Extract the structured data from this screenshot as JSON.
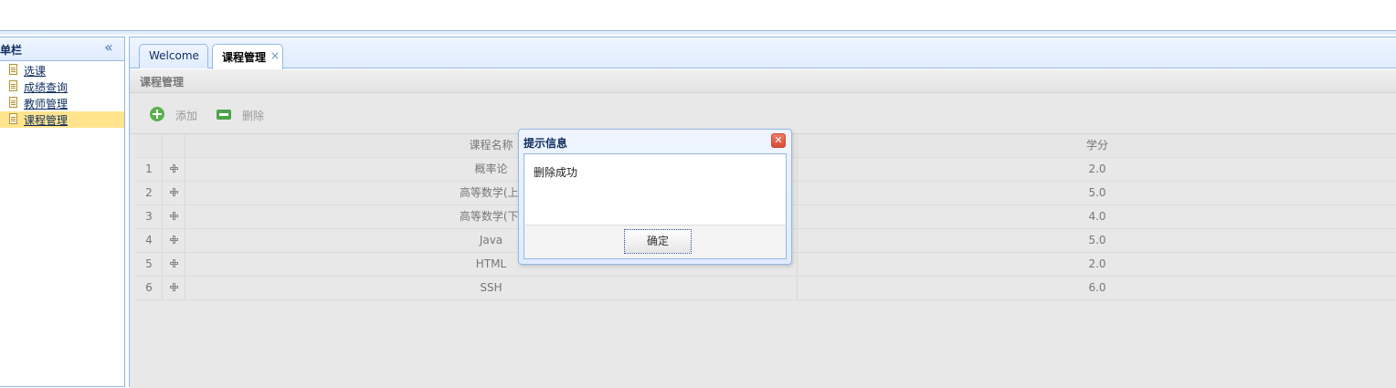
{
  "sidebar": {
    "title": "菜单栏",
    "items": [
      {
        "label": "选课",
        "selected": false
      },
      {
        "label": "成绩查询",
        "selected": false
      },
      {
        "label": "教师管理",
        "selected": false
      },
      {
        "label": "课程管理",
        "selected": true
      }
    ]
  },
  "tabs": [
    {
      "label": "Welcome",
      "active": false
    },
    {
      "label": "课程管理",
      "active": true,
      "close": "×"
    }
  ],
  "panel": {
    "title": "课程管理"
  },
  "toolbar": {
    "add_label": "添加",
    "delete_label": "删除"
  },
  "grid": {
    "columns": [
      "课程名称",
      "学分"
    ],
    "rows": [
      {
        "num": "1",
        "name": "概率论",
        "credit": "2.0"
      },
      {
        "num": "2",
        "name": "高等数学(上)",
        "credit": "5.0"
      },
      {
        "num": "3",
        "name": "高等数学(下)",
        "credit": "4.0"
      },
      {
        "num": "4",
        "name": "Java",
        "credit": "5.0"
      },
      {
        "num": "5",
        "name": "HTML",
        "credit": "2.0"
      },
      {
        "num": "6",
        "name": "SSH",
        "credit": "6.0"
      }
    ]
  },
  "dialog": {
    "title": "提示信息",
    "message": "删除成功",
    "ok_label": "确定"
  },
  "colors": {
    "accent_border": "#95b8e7",
    "selected_row": "#ffe48d",
    "header_bg": "#e0ecff"
  }
}
